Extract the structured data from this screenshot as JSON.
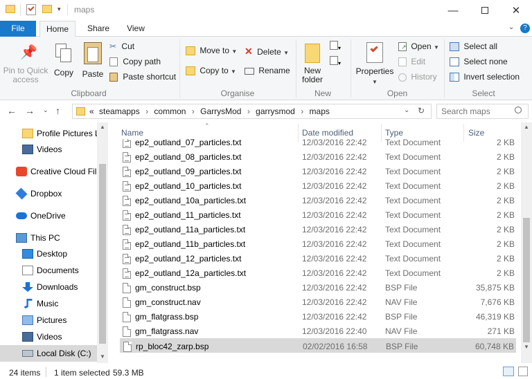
{
  "window": {
    "title": "maps"
  },
  "tabs": {
    "file": "File",
    "home": "Home",
    "share": "Share",
    "view": "View"
  },
  "ribbon": {
    "clipboard": {
      "pin": "Pin to Quick access",
      "copy": "Copy",
      "paste": "Paste",
      "cut": "Cut",
      "copy_path": "Copy path",
      "paste_shortcut": "Paste shortcut",
      "label": "Clipboard"
    },
    "organise": {
      "move_to": "Move to",
      "copy_to": "Copy to",
      "delete": "Delete",
      "rename": "Rename",
      "label": "Organise"
    },
    "new": {
      "new_folder": "New folder",
      "label": "New"
    },
    "open": {
      "properties": "Properties",
      "open": "Open",
      "edit": "Edit",
      "history": "History",
      "label": "Open"
    },
    "select": {
      "select_all": "Select all",
      "select_none": "Select none",
      "invert": "Invert selection",
      "label": "Select"
    }
  },
  "address": {
    "crumbs": [
      "steamapps",
      "common",
      "GarrysMod",
      "garrysmod",
      "maps"
    ],
    "overflow": "«",
    "search_placeholder": "Search maps"
  },
  "nav": [
    {
      "label": "Profile Pictures L",
      "icon": "folder-icon",
      "indent": true
    },
    {
      "label": "Videos",
      "icon": "video-folder-icon",
      "indent": true
    },
    {
      "label": "Creative Cloud Fil",
      "icon": "creative-cloud-icon",
      "indent": false
    },
    {
      "label": "Dropbox",
      "icon": "dropbox-icon",
      "indent": false
    },
    {
      "label": "OneDrive",
      "icon": "onedrive-icon",
      "indent": false
    },
    {
      "label": "This PC",
      "icon": "computer-icon",
      "indent": false
    },
    {
      "label": "Desktop",
      "icon": "desktop-icon",
      "indent": true
    },
    {
      "label": "Documents",
      "icon": "documents-icon",
      "indent": true
    },
    {
      "label": "Downloads",
      "icon": "downloads-icon",
      "indent": true
    },
    {
      "label": "Music",
      "icon": "music-icon",
      "indent": true
    },
    {
      "label": "Pictures",
      "icon": "pictures-icon",
      "indent": true
    },
    {
      "label": "Videos",
      "icon": "video-folder-icon",
      "indent": true
    },
    {
      "label": "Local Disk (C:)",
      "icon": "drive-icon",
      "indent": true,
      "selected": true
    }
  ],
  "columns": {
    "name": "Name",
    "date": "Date modified",
    "type": "Type",
    "size": "Size"
  },
  "files": [
    {
      "name": "ep2_outland_07_particles.txt",
      "date": "12/03/2016 22:42",
      "type": "Text Document",
      "size": "2 KB",
      "icon": "text-file-icon"
    },
    {
      "name": "ep2_outland_08_particles.txt",
      "date": "12/03/2016 22:42",
      "type": "Text Document",
      "size": "2 KB",
      "icon": "text-file-icon"
    },
    {
      "name": "ep2_outland_09_particles.txt",
      "date": "12/03/2016 22:42",
      "type": "Text Document",
      "size": "2 KB",
      "icon": "text-file-icon"
    },
    {
      "name": "ep2_outland_10_particles.txt",
      "date": "12/03/2016 22:42",
      "type": "Text Document",
      "size": "2 KB",
      "icon": "text-file-icon"
    },
    {
      "name": "ep2_outland_10a_particles.txt",
      "date": "12/03/2016 22:42",
      "type": "Text Document",
      "size": "2 KB",
      "icon": "text-file-icon"
    },
    {
      "name": "ep2_outland_11_particles.txt",
      "date": "12/03/2016 22:42",
      "type": "Text Document",
      "size": "2 KB",
      "icon": "text-file-icon"
    },
    {
      "name": "ep2_outland_11a_particles.txt",
      "date": "12/03/2016 22:42",
      "type": "Text Document",
      "size": "2 KB",
      "icon": "text-file-icon"
    },
    {
      "name": "ep2_outland_11b_particles.txt",
      "date": "12/03/2016 22:42",
      "type": "Text Document",
      "size": "2 KB",
      "icon": "text-file-icon"
    },
    {
      "name": "ep2_outland_12_particles.txt",
      "date": "12/03/2016 22:42",
      "type": "Text Document",
      "size": "2 KB",
      "icon": "text-file-icon"
    },
    {
      "name": "ep2_outland_12a_particles.txt",
      "date": "12/03/2016 22:42",
      "type": "Text Document",
      "size": "2 KB",
      "icon": "text-file-icon"
    },
    {
      "name": "gm_construct.bsp",
      "date": "12/03/2016 22:42",
      "type": "BSP File",
      "size": "35,875 KB",
      "icon": "file-icon"
    },
    {
      "name": "gm_construct.nav",
      "date": "12/03/2016 22:42",
      "type": "NAV File",
      "size": "7,676 KB",
      "icon": "file-icon"
    },
    {
      "name": "gm_flatgrass.bsp",
      "date": "12/03/2016 22:42",
      "type": "BSP File",
      "size": "46,319 KB",
      "icon": "file-icon"
    },
    {
      "name": "gm_flatgrass.nav",
      "date": "12/03/2016 22:40",
      "type": "NAV File",
      "size": "271 KB",
      "icon": "file-icon"
    },
    {
      "name": "rp_bloc42_zarp.bsp",
      "date": "02/02/2016 16:58",
      "type": "BSP File",
      "size": "60,748 KB",
      "icon": "file-icon",
      "selected": true
    }
  ],
  "status": {
    "count": "24 items",
    "selection": "1 item selected",
    "size": "59.3 MB"
  }
}
